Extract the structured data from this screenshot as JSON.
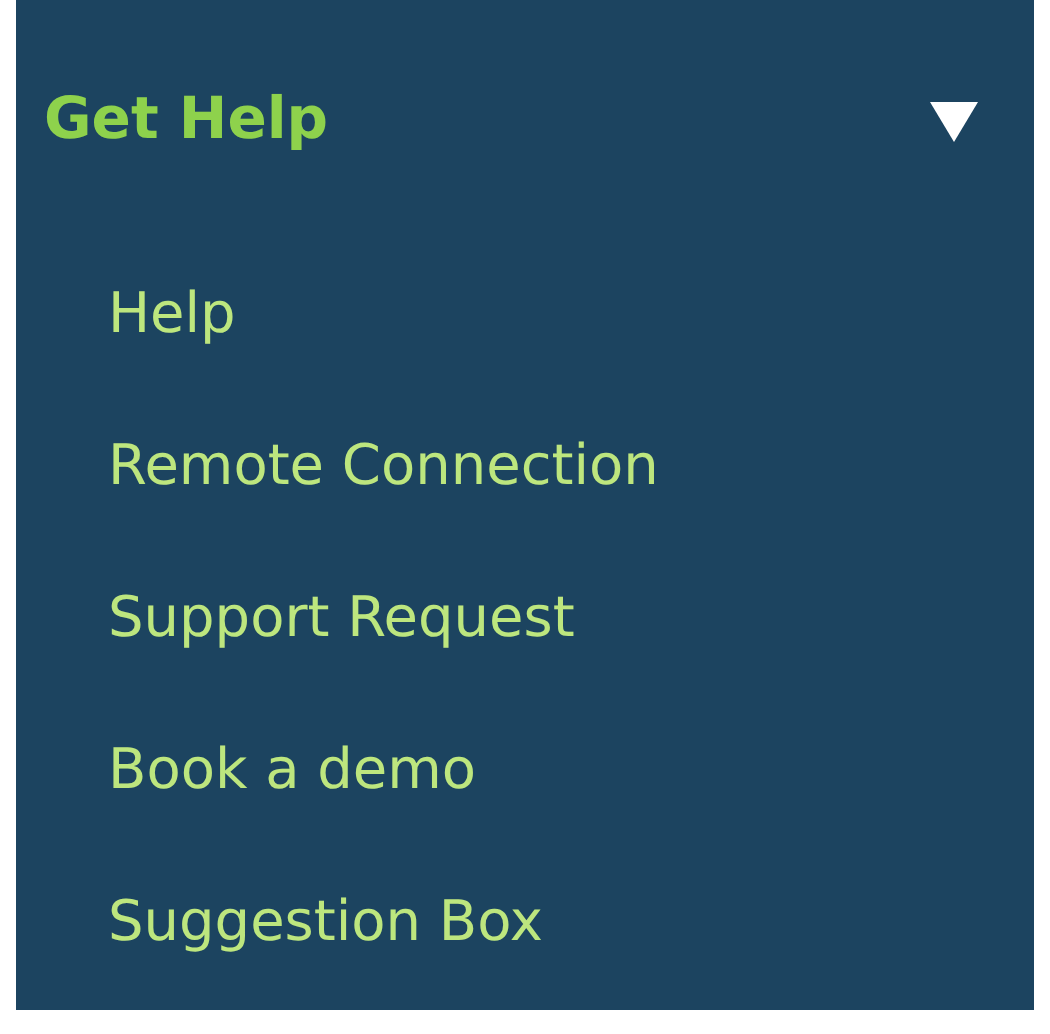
{
  "menu": {
    "title": "Get Help",
    "expanded": true,
    "items": [
      {
        "label": "Help"
      },
      {
        "label": "Remote Connection"
      },
      {
        "label": "Support Request"
      },
      {
        "label": "Book a demo"
      },
      {
        "label": "Suggestion Box"
      }
    ]
  }
}
